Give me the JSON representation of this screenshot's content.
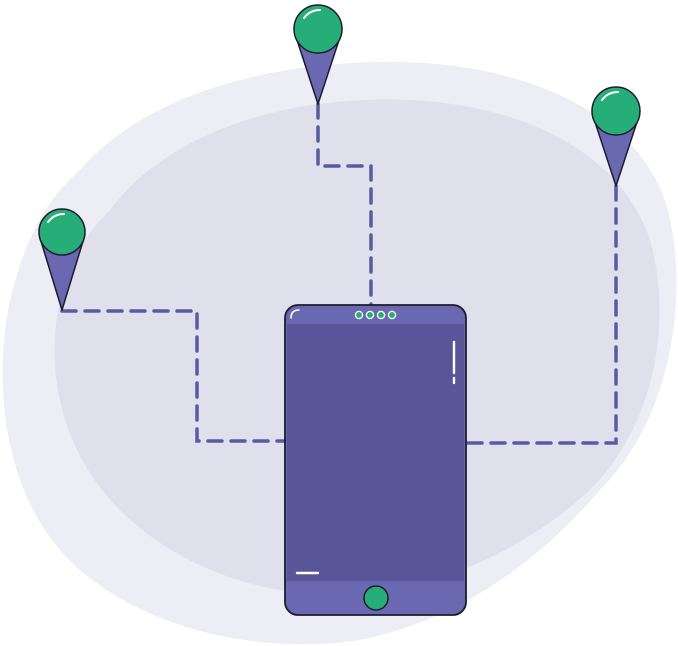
{
  "illustration": {
    "subject": "phone-location-pins",
    "colors": {
      "background": "#ffffff",
      "blob_outer": "#ededf5",
      "blob_inner": "#e0e0ec",
      "route_dash": "#5a5a9e",
      "phone_body": "#585698",
      "phone_frame": "#6a68b0",
      "phone_outline": "#1c1c2e",
      "pin_head": "#27ae78",
      "pin_tail": "#6a68b0",
      "accent_white": "#ffffff"
    },
    "icons": {
      "pins": [
        "map-pin-icon",
        "map-pin-icon",
        "map-pin-icon"
      ],
      "phone": "smartphone-icon",
      "home_button": "home-button-icon"
    },
    "pin_count": 3,
    "speaker_dot_count": 4
  }
}
